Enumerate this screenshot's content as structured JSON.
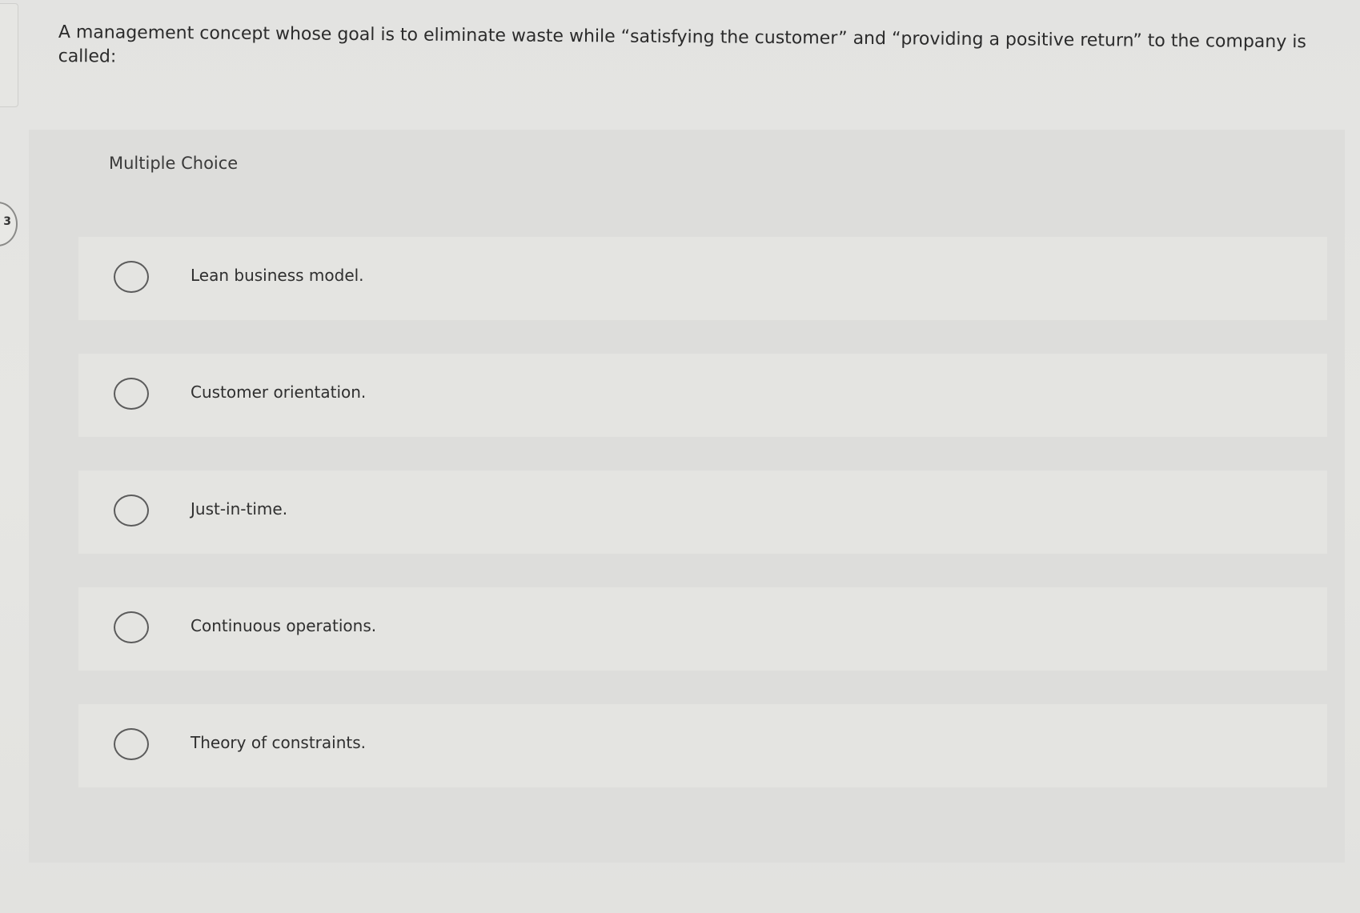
{
  "question": {
    "text": "A management concept whose goal is to eliminate waste while “satisfying the customer” and “providing a positive return” to the company is called:"
  },
  "side_badge": {
    "label": "3"
  },
  "multiple_choice": {
    "title": "Multiple Choice",
    "options": [
      {
        "label": "Lean business model.",
        "selected": false
      },
      {
        "label": "Customer orientation.",
        "selected": false
      },
      {
        "label": "Just-in-time.",
        "selected": false
      },
      {
        "label": "Continuous operations.",
        "selected": false
      },
      {
        "label": "Theory of constraints.",
        "selected": false
      }
    ]
  }
}
